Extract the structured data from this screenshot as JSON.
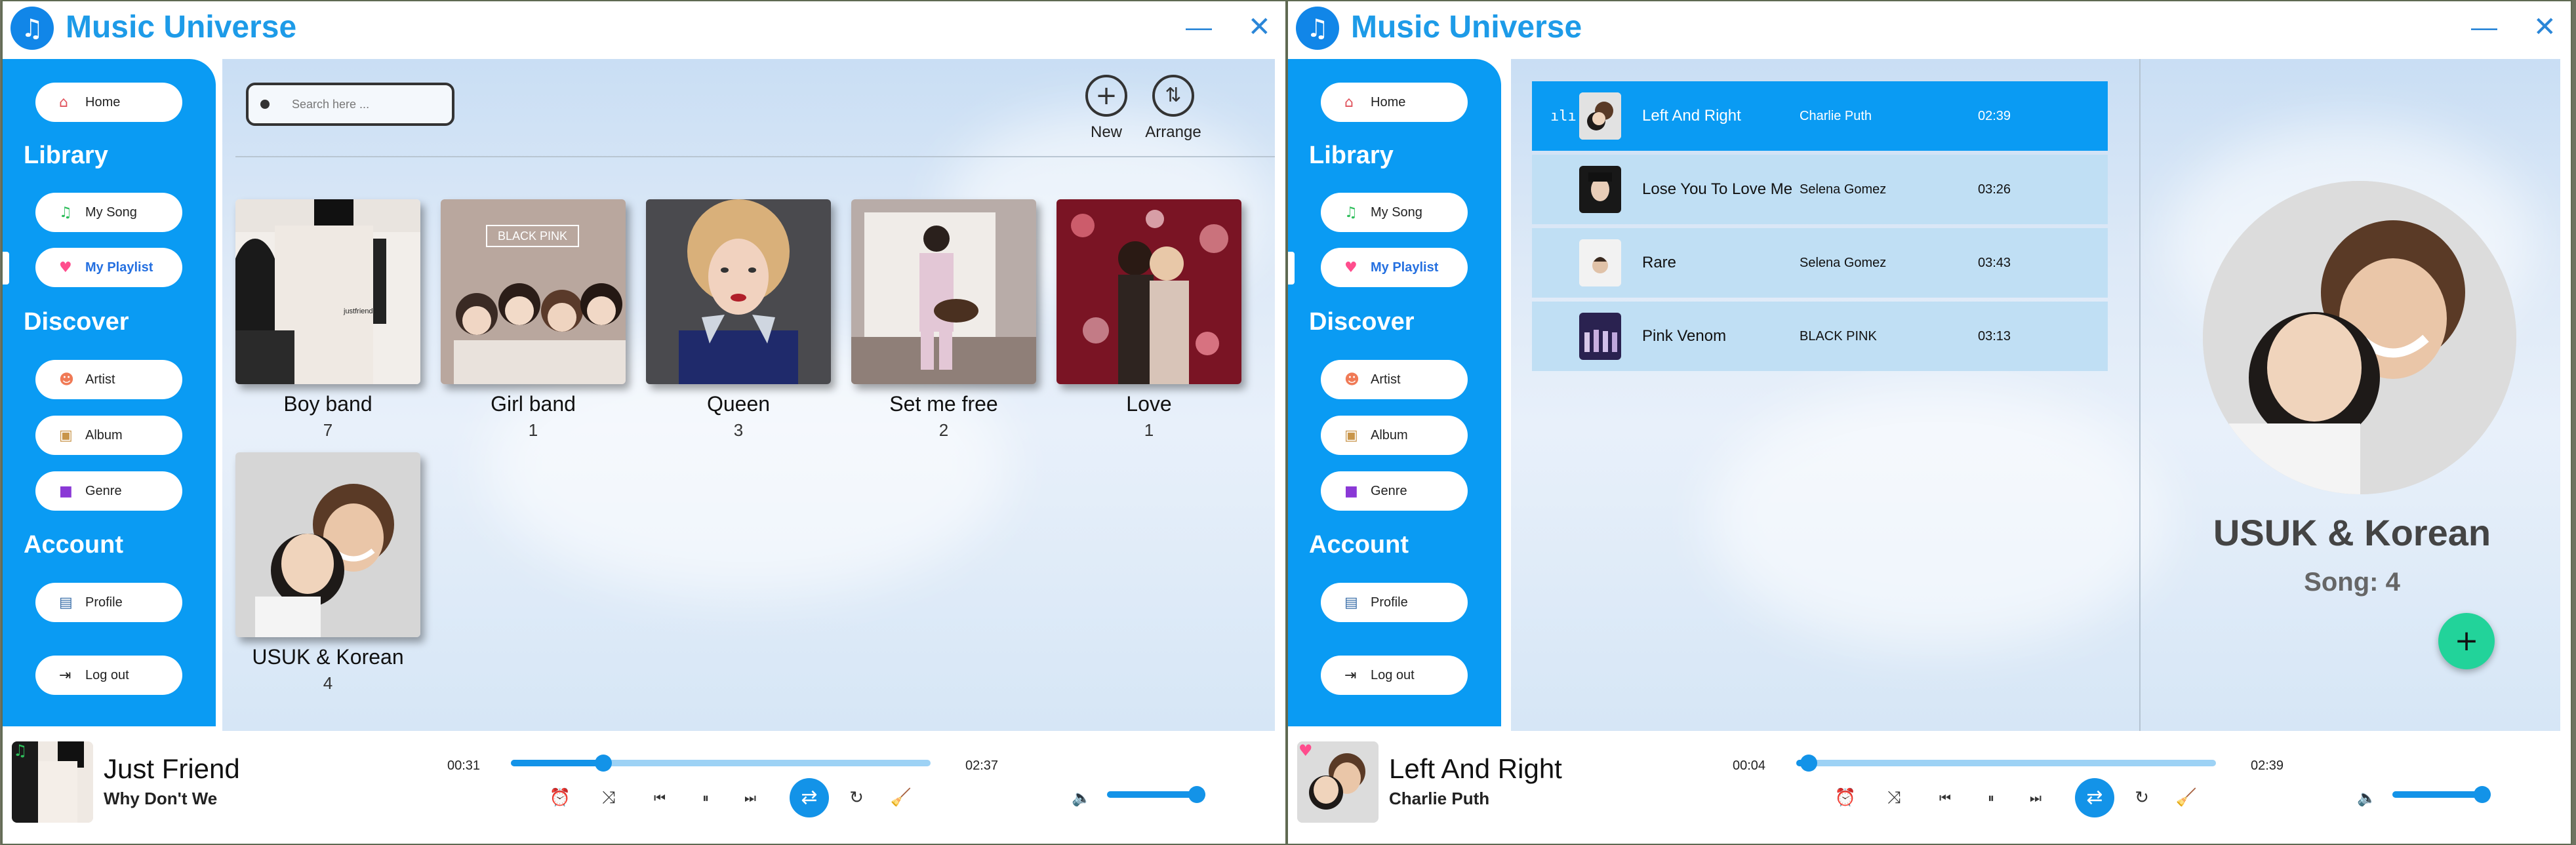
{
  "app": {
    "title": "Music Universe",
    "logo_icon": "music-note-icon",
    "minimize": "—",
    "close": "✕"
  },
  "sidebar": {
    "home": "Home",
    "library_heading": "Library",
    "my_song": "My Song",
    "my_playlist": "My Playlist",
    "discover_heading": "Discover",
    "artist": "Artist",
    "album": "Album",
    "genre": "Genre",
    "account_heading": "Account",
    "profile": "Profile",
    "logout": "Log out"
  },
  "left": {
    "search_placeholder": "Search here ...",
    "new_label": "New",
    "arrange_label": "Arrange",
    "playlists": [
      {
        "name": "Boy band",
        "count": "7"
      },
      {
        "name": "Girl band",
        "count": "1"
      },
      {
        "name": "Queen",
        "count": "3"
      },
      {
        "name": "Set me free",
        "count": "2"
      },
      {
        "name": "Love",
        "count": "1"
      },
      {
        "name": "USUK & Korean",
        "count": "4"
      }
    ],
    "girl_band_art_text": "BLACK PINK",
    "boy_band_art_text": "justfriends",
    "player": {
      "title": "Just Friend",
      "artist": "Why Don't We",
      "current": "00:31",
      "total": "02:37",
      "progress": 0.22,
      "volume": 1.0
    }
  },
  "right": {
    "songs": [
      {
        "title": "Left And Right",
        "artist": "Charlie Puth",
        "duration": "02:39"
      },
      {
        "title": "Lose You To Love Me",
        "artist": "Selena Gomez",
        "duration": "03:26"
      },
      {
        "title": "Rare",
        "artist": "Selena Gomez",
        "duration": "03:43"
      },
      {
        "title": "Pink Venom",
        "artist": "BLACK PINK",
        "duration": "03:13"
      }
    ],
    "playing_bars": "ılı",
    "playlist_title": "USUK & Korean",
    "playlist_songs": "Song: 4",
    "add_label": "+",
    "player": {
      "title": "Left And Right",
      "artist": "Charlie Puth",
      "current": "00:04",
      "total": "02:39",
      "progress": 0.03,
      "volume": 1.0
    }
  },
  "controls": {
    "alarm": "⏰",
    "shuffle": "⤨",
    "prev": "⏮",
    "pause": "⏸",
    "next": "⏭",
    "repeat": "⇄",
    "replay": "↻",
    "broom": "🧹",
    "volume": "🔈"
  },
  "colors": {
    "accent": "#0a9bf3",
    "title": "#1d9be8",
    "fab": "#22d39a",
    "selected_row": "#0a9bf3",
    "row": "#c0dff4"
  }
}
